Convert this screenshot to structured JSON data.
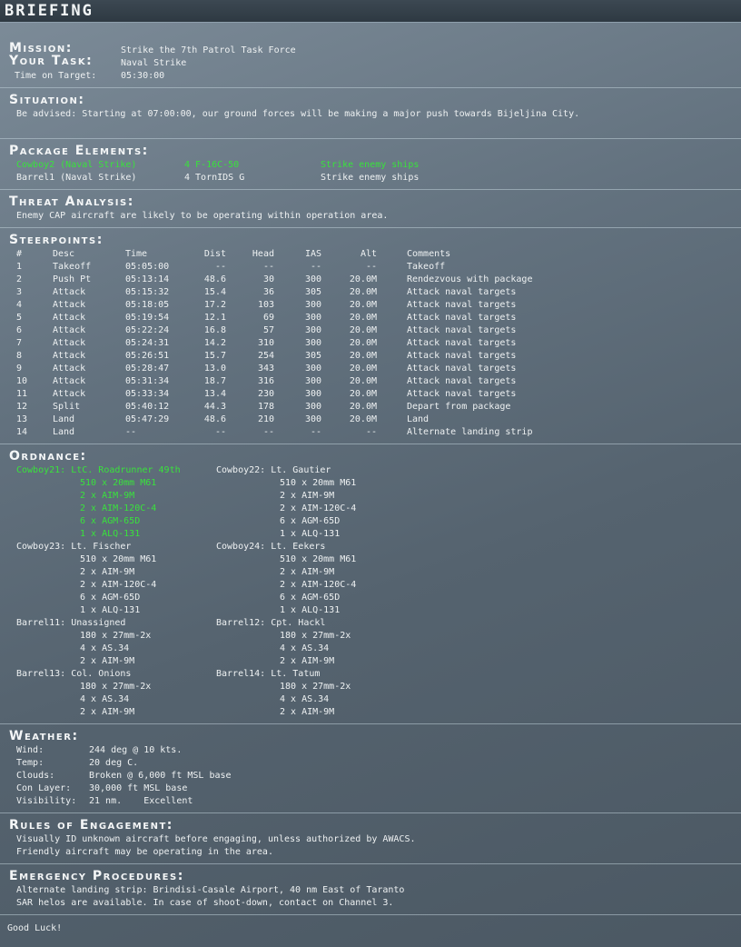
{
  "title": "BRIEFING",
  "mission": {
    "mission_label": "Mission:",
    "mission_value": "Strike the 7th Patrol Task Force",
    "task_label": "Your Task:",
    "task_value": "Naval Strike",
    "tot_label": "Time on Target:",
    "tot_value": "05:30:00"
  },
  "situation": {
    "heading": "Situation:",
    "text": "Be advised: Starting at 07:00:00, our ground forces will be making a major push towards Bijeljina City."
  },
  "package": {
    "heading": "Package Elements:",
    "rows": [
      {
        "name": "Cowboy2 (Naval Strike)",
        "aircraft": "4 F-16C-50",
        "task": "Strike enemy ships",
        "highlight": true
      },
      {
        "name": "Barrel1 (Naval Strike)",
        "aircraft": "4 TornIDS G",
        "task": "Strike enemy ships",
        "highlight": false
      }
    ]
  },
  "threat": {
    "heading": "Threat Analysis:",
    "text": "Enemy CAP aircraft are likely to be operating within operation area."
  },
  "steerpoints": {
    "heading": "Steerpoints:",
    "columns": [
      "#",
      "Desc",
      "Time",
      "Dist",
      "Head",
      "IAS",
      "Alt",
      "Comments"
    ],
    "rows": [
      [
        "1",
        "Takeoff",
        "05:05:00",
        "--",
        "--",
        "--",
        "--",
        "Takeoff"
      ],
      [
        "2",
        "Push Pt",
        "05:13:14",
        "48.6",
        "30",
        "300",
        "20.0M",
        "Rendezvous with package"
      ],
      [
        "3",
        "Attack",
        "05:15:32",
        "15.4",
        "36",
        "305",
        "20.0M",
        "Attack naval targets"
      ],
      [
        "4",
        "Attack",
        "05:18:05",
        "17.2",
        "103",
        "300",
        "20.0M",
        "Attack naval targets"
      ],
      [
        "5",
        "Attack",
        "05:19:54",
        "12.1",
        "69",
        "300",
        "20.0M",
        "Attack naval targets"
      ],
      [
        "6",
        "Attack",
        "05:22:24",
        "16.8",
        "57",
        "300",
        "20.0M",
        "Attack naval targets"
      ],
      [
        "7",
        "Attack",
        "05:24:31",
        "14.2",
        "310",
        "300",
        "20.0M",
        "Attack naval targets"
      ],
      [
        "8",
        "Attack",
        "05:26:51",
        "15.7",
        "254",
        "305",
        "20.0M",
        "Attack naval targets"
      ],
      [
        "9",
        "Attack",
        "05:28:47",
        "13.0",
        "343",
        "300",
        "20.0M",
        "Attack naval targets"
      ],
      [
        "10",
        "Attack",
        "05:31:34",
        "18.7",
        "316",
        "300",
        "20.0M",
        "Attack naval targets"
      ],
      [
        "11",
        "Attack",
        "05:33:34",
        "13.4",
        "230",
        "300",
        "20.0M",
        "Attack naval targets"
      ],
      [
        "12",
        "Split",
        "05:40:12",
        "44.3",
        "178",
        "300",
        "20.0M",
        "Depart from package"
      ],
      [
        "13",
        "Land",
        "05:47:29",
        "48.6",
        "210",
        "300",
        "20.0M",
        "Land"
      ],
      [
        "14",
        "Land",
        "--",
        "--",
        "--",
        "--",
        "--",
        "Alternate landing strip"
      ]
    ]
  },
  "ordnance": {
    "heading": "Ordnance:",
    "left": [
      {
        "pilot": "Cowboy21: LtC. Roadrunner 49th",
        "highlight": true,
        "items": [
          "510 x 20mm M61",
          "2 x AIM-9M",
          "2 x AIM-120C-4",
          "6 x AGM-65D",
          "1 x ALQ-131"
        ]
      },
      {
        "pilot": "Cowboy23: Lt. Fischer",
        "highlight": false,
        "items": [
          "510 x 20mm M61",
          "2 x AIM-9M",
          "2 x AIM-120C-4",
          "6 x AGM-65D",
          "1 x ALQ-131"
        ]
      },
      {
        "pilot": "Barrel11: Unassigned",
        "highlight": false,
        "items": [
          "180 x 27mm-2x",
          "4 x AS.34",
          "2 x AIM-9M"
        ]
      },
      {
        "pilot": "Barrel13: Col. Onions",
        "highlight": false,
        "items": [
          "180 x 27mm-2x",
          "4 x AS.34",
          "2 x AIM-9M"
        ]
      }
    ],
    "right": [
      {
        "pilot": "Cowboy22: Lt. Gautier",
        "highlight": false,
        "items": [
          "510 x 20mm M61",
          "2 x AIM-9M",
          "2 x AIM-120C-4",
          "6 x AGM-65D",
          "1 x ALQ-131"
        ]
      },
      {
        "pilot": "Cowboy24: Lt. Eekers",
        "highlight": false,
        "items": [
          "510 x 20mm M61",
          "2 x AIM-9M",
          "2 x AIM-120C-4",
          "6 x AGM-65D",
          "1 x ALQ-131"
        ]
      },
      {
        "pilot": "Barrel12: Cpt. Hackl",
        "highlight": false,
        "items": [
          "180 x 27mm-2x",
          "4 x AS.34",
          "2 x AIM-9M"
        ]
      },
      {
        "pilot": "Barrel14: Lt. Tatum",
        "highlight": false,
        "items": [
          "180 x 27mm-2x",
          "4 x AS.34",
          "2 x AIM-9M"
        ]
      }
    ]
  },
  "weather": {
    "heading": "Weather:",
    "rows": [
      {
        "label": "Wind:",
        "value": "244 deg @ 10 kts."
      },
      {
        "label": "Temp:",
        "value": "20 deg C."
      },
      {
        "label": "Clouds:",
        "value": "Broken @ 6,000 ft MSL base"
      },
      {
        "label": "Con Layer:",
        "value": "30,000 ft MSL base"
      },
      {
        "label": "Visibility:",
        "value": "21 nm.    Excellent"
      }
    ]
  },
  "roe": {
    "heading": "Rules of Engagement:",
    "lines": [
      "Visually ID unknown aircraft before engaging, unless authorized by AWACS.",
      "Friendly aircraft may be operating in the area."
    ]
  },
  "emergency": {
    "heading": "Emergency Procedures:",
    "lines": [
      "Alternate landing strip: Brindisi-Casale Airport, 40 nm East of Taranto",
      "SAR helos are available. In case of shoot-down, contact on Channel 3."
    ]
  },
  "closing": "Good Luck!",
  "colors": {
    "highlight": "#39e23c",
    "text": "#eef1f2",
    "title_bar": "#2e3942"
  }
}
